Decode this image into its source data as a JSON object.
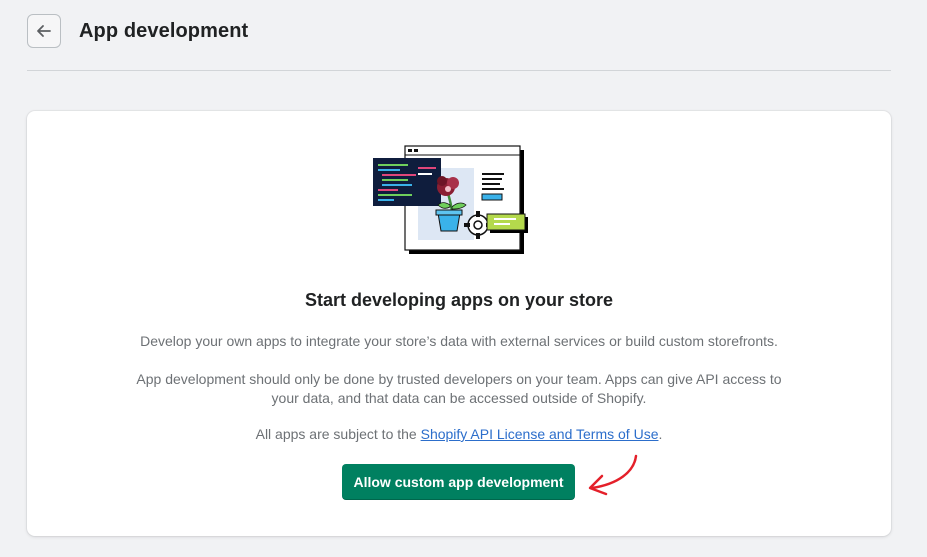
{
  "header": {
    "title": "App development",
    "back_icon": "arrow-left-icon"
  },
  "empty_state": {
    "illustration": "app-window-illustration",
    "title": "Start developing apps on your store",
    "description_1": "Develop your own apps to integrate your store’s data with external services or build custom storefronts.",
    "description_2": "App development should only be done by trusted developers on your team. Apps can give API access to your data, and that data can be accessed outside of Shopify.",
    "terms_prefix": "All apps are subject to the ",
    "terms_link": "Shopify API License and Terms of Use",
    "terms_suffix": ".",
    "button_label": "Allow custom app development"
  },
  "colors": {
    "primary_button": "#008060",
    "link": "#2c6ecb",
    "annotation_arrow": "#e4202a"
  }
}
